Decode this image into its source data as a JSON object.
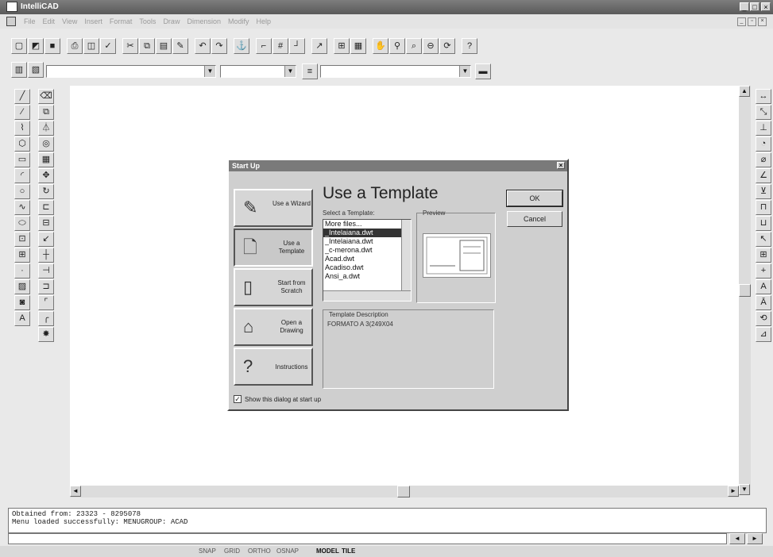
{
  "window": {
    "title": "IntelliCAD"
  },
  "menubar": {
    "items": [
      "File",
      "Edit",
      "View",
      "Insert",
      "Format",
      "Tools",
      "Draw",
      "Dimension",
      "Modify",
      "Help"
    ]
  },
  "command_history": [
    "Obtained from:  23323 - 8295078",
    "Menu loaded successfully: MENUGROUP: ACAD"
  ],
  "statusbar": {
    "items": [
      "SNAP",
      "GRID",
      "ORTHO",
      "OSNAP",
      "MODEL",
      "TILE"
    ]
  },
  "dialog": {
    "title": "Start Up",
    "heading": "Use a Template",
    "options": [
      {
        "label": "Use a Wizard",
        "icon": "wizard-icon"
      },
      {
        "label": "Use a Template",
        "icon": "template-icon"
      },
      {
        "label": "Start from Scratch",
        "icon": "blank-page-icon"
      },
      {
        "label": "Open a Drawing",
        "icon": "open-folder-icon"
      },
      {
        "label": "Instructions",
        "icon": "question-icon"
      }
    ],
    "select_label": "Select a Template:",
    "templates": [
      "More files...",
      "_Intelaiana.dwt",
      "_Intelaiana.dwt",
      "_c-merona.dwt",
      "Acad.dwt",
      "Acadiso.dwt",
      "Ansi_a.dwt"
    ],
    "selected_template": "_Intelaiana.dwt",
    "preview_label": "Preview",
    "description_label": "Template Description",
    "description": "FORMATO A 3(249X04",
    "ok_label": "OK",
    "cancel_label": "Cancel",
    "show_on_startup_label": "Show this dialog at start up",
    "show_on_startup_checked": true
  }
}
